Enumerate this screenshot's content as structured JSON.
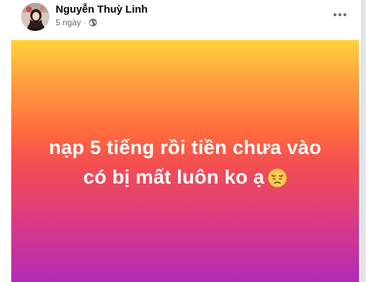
{
  "post": {
    "author": "Nguyễn Thuỳ Linh",
    "time": "5 ngày",
    "separator": "·",
    "privacy_icon": "globe-icon",
    "more_icon": "more-horizontal-icon",
    "text_line1": "nạp 5 tiếng rồi tiền chưa vào",
    "text_line2": "có bị mất luôn ko ạ",
    "emoji": "disappointed-face-emoji",
    "background_gradient": [
      "#ffd23a",
      "#ff6b3d",
      "#b22ab8"
    ]
  }
}
